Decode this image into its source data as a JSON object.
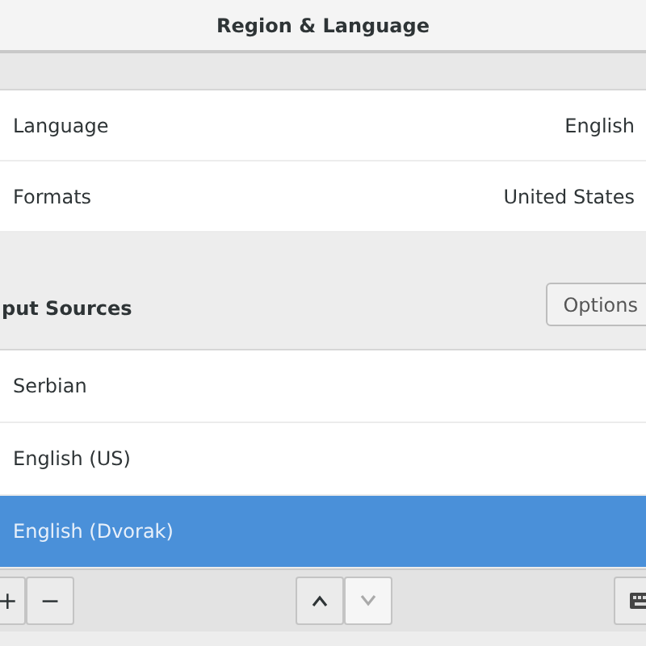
{
  "window": {
    "title": "Region & Language"
  },
  "settings": [
    {
      "label": "Language",
      "value": "English"
    },
    {
      "label": "Formats",
      "value": "United States"
    }
  ],
  "input_sources": {
    "heading": "put Sources",
    "options_button": "Options",
    "items": [
      {
        "label": "Serbian",
        "selected": false
      },
      {
        "label": "English (US)",
        "selected": false
      },
      {
        "label": "English (Dvorak)",
        "selected": true
      }
    ]
  },
  "toolbar": {
    "add": "+",
    "remove": "−",
    "move_up_disabled": false,
    "move_down_disabled": true
  }
}
